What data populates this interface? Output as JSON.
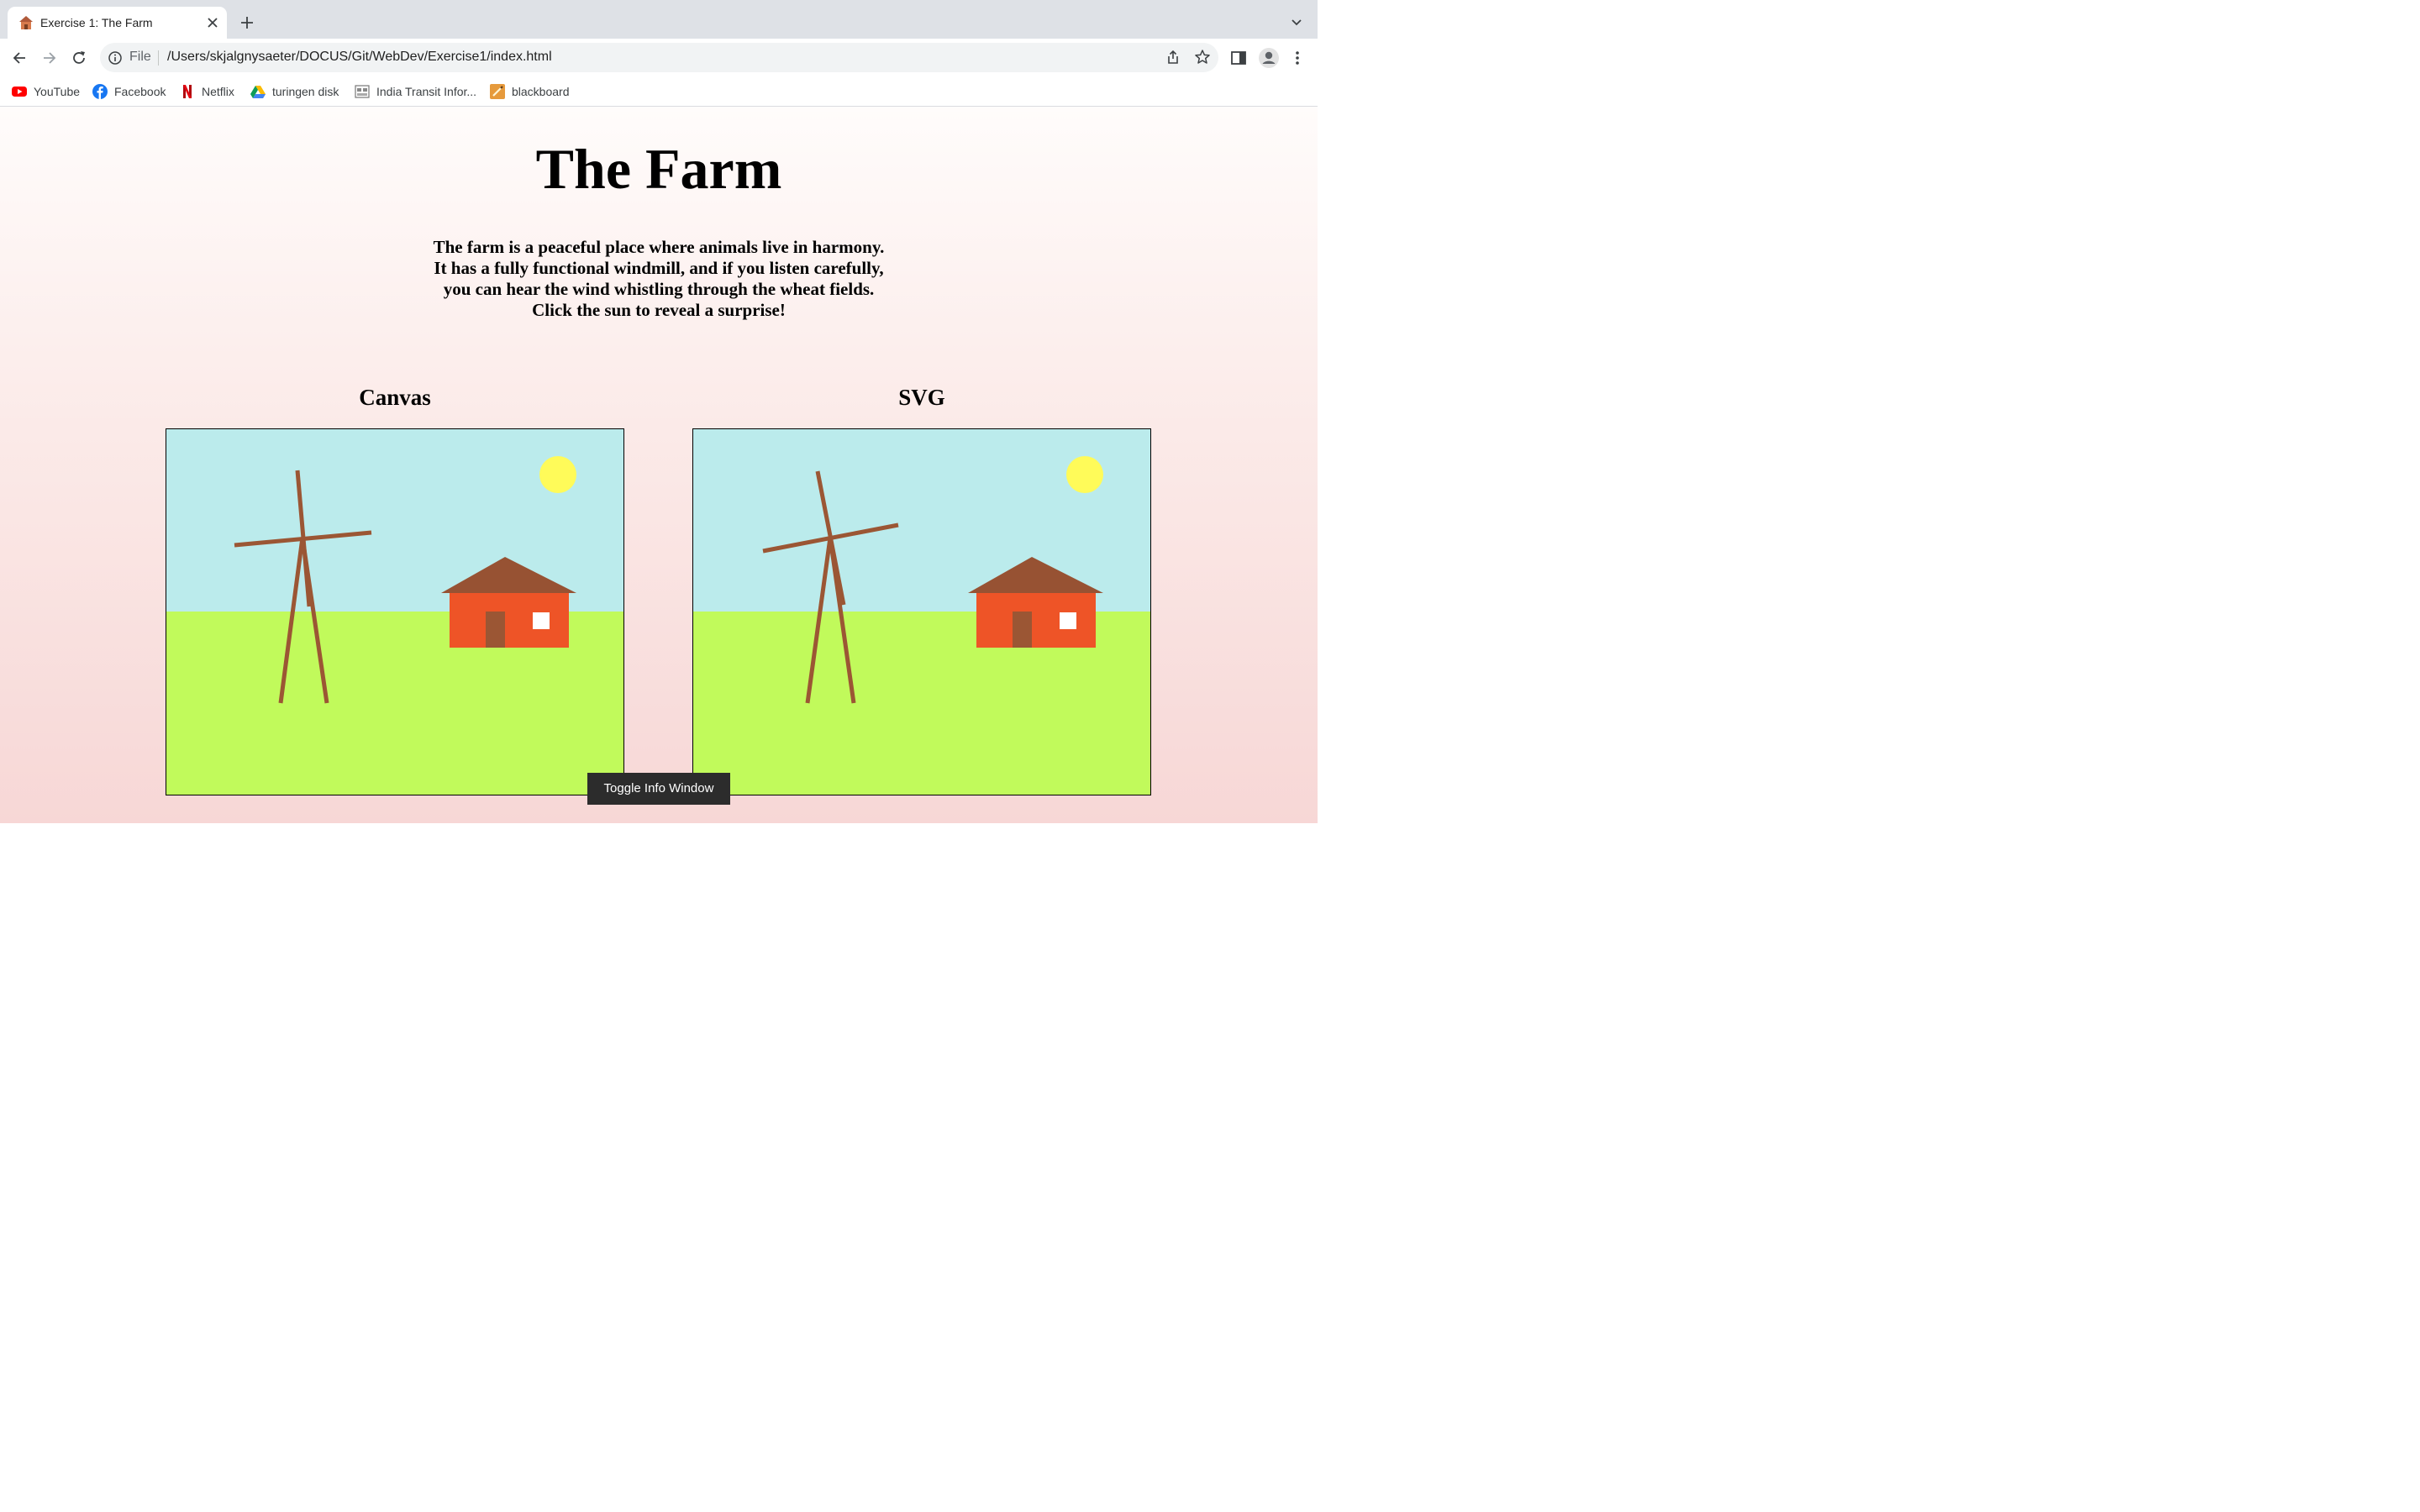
{
  "browser": {
    "tab_title": "Exercise 1: The Farm",
    "address_scheme": "File",
    "address_url": "/Users/skjalgnysaeter/DOCUS/Git/WebDev/Exercise1/index.html",
    "bookmarks": [
      {
        "label": "YouTube",
        "icon": "youtube-icon"
      },
      {
        "label": "Facebook",
        "icon": "facebook-icon"
      },
      {
        "label": "Netflix",
        "icon": "netflix-icon"
      },
      {
        "label": "turingen disk",
        "icon": "google-drive-icon"
      },
      {
        "label": "India Transit Infor...",
        "icon": "transit-icon"
      },
      {
        "label": "blackboard",
        "icon": "blackboard-icon"
      }
    ]
  },
  "page": {
    "title": "The Farm",
    "description": "The farm is a peaceful place where animals live in harmony. It has a fully functional windmill, and if you listen carefully, you can hear the wind whistling through the wheat fields. Click the sun to reveal a surprise!",
    "canvas_heading": "Canvas",
    "svg_heading": "SVG",
    "toggle_button": "Toggle Info Window"
  },
  "colors": {
    "sky": "#bbebec",
    "grass": "#c1fa5b",
    "sun": "#fffb59",
    "wood": "#9b5634",
    "house_wall": "#ee5427",
    "house_window": "#ffffff",
    "roof": "#975233",
    "door": "#9b5634"
  }
}
